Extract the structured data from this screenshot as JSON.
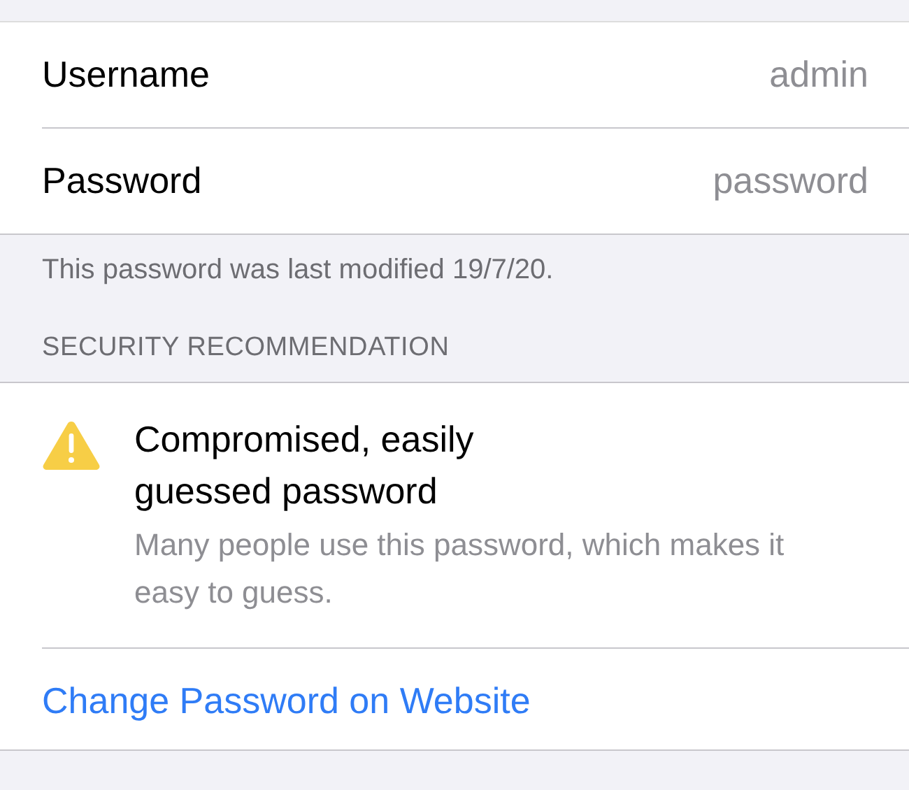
{
  "credentials": [
    {
      "label": "Username",
      "value": "admin"
    },
    {
      "label": "Password",
      "value": "password"
    }
  ],
  "footer": "This password was last modified 19/7/20.",
  "section_header": "SECURITY RECOMMENDATION",
  "recommendation": {
    "title": "Compromised, easily guessed password",
    "description": "Many people use this password, which makes it easy to guess."
  },
  "link": "Change Password on Website"
}
